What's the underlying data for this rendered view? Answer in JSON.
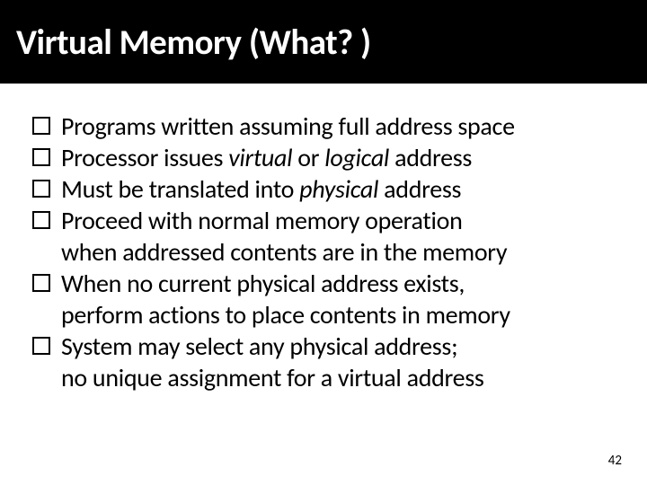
{
  "title": "Virtual Memory (What? )",
  "bullets": [
    {
      "html": "Programs written assuming full address space"
    },
    {
      "html": "Processor issues <em>virtual</em> or <em>logical</em> address"
    },
    {
      "html": "Must be translated into <em>physical</em> address"
    },
    {
      "html": "Proceed with normal memory operation<br>when addressed contents are in the memory"
    },
    {
      "html": "When no current physical address exists,<br>perform actions to place contents in memory"
    },
    {
      "html": "System may select any physical address;<br>no unique assignment for a virtual address"
    }
  ],
  "page_number": "42"
}
